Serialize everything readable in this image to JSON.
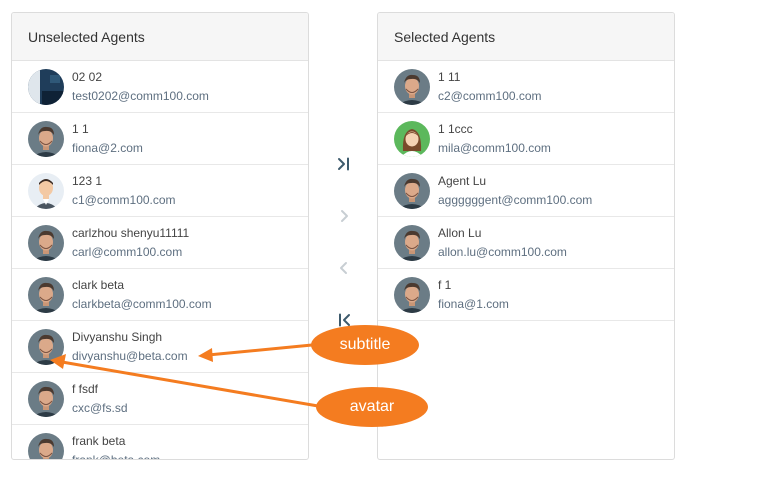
{
  "left_panel": {
    "title": "Unselected Agents",
    "agents": [
      {
        "name": "02 02",
        "email": "test0202@comm100.com",
        "avatar": "dark-photo"
      },
      {
        "name": "1 1",
        "email": "fiona@2.com",
        "avatar": "man-photo"
      },
      {
        "name": "123 1",
        "email": "c1@comm100.com",
        "avatar": "man-cartoon"
      },
      {
        "name": "carlzhou shenyu11111",
        "email": "carl@comm100.com",
        "avatar": "man-photo"
      },
      {
        "name": "clark beta",
        "email": "clarkbeta@comm100.com",
        "avatar": "man-photo"
      },
      {
        "name": "Divyanshu Singh",
        "email": "divyanshu@beta.com",
        "avatar": "man-photo"
      },
      {
        "name": "f fsdf",
        "email": "cxc@fs.sd",
        "avatar": "man-photo"
      },
      {
        "name": "frank beta",
        "email": "frank@beta.com",
        "avatar": "man-photo"
      }
    ]
  },
  "right_panel": {
    "title": "Selected Agents",
    "agents": [
      {
        "name": "1 11",
        "email": "c2@comm100.com",
        "avatar": "man-photo"
      },
      {
        "name": "1 1ccc",
        "email": "mila@comm100.com",
        "avatar": "woman-cartoon"
      },
      {
        "name": "Agent Lu",
        "email": "aggggggent@comm100.com",
        "avatar": "man-photo"
      },
      {
        "name": "Allon Lu",
        "email": "allon.lu@comm100.com",
        "avatar": "man-photo"
      },
      {
        "name": "f 1",
        "email": "fiona@1.com",
        "avatar": "man-photo"
      }
    ]
  },
  "controls": {
    "move_all_right": "move-all-right-icon",
    "move_right": "chevron-right-icon",
    "move_left": "chevron-left-icon",
    "move_all_left": "move-all-left-icon"
  },
  "annotations": {
    "subtitle_label": "subtitle",
    "avatar_label": "avatar",
    "color": "#f47c20"
  },
  "colors": {
    "accent": "#3d5a6c",
    "disabled": "#c8ced3",
    "email": "#5e6f80"
  }
}
